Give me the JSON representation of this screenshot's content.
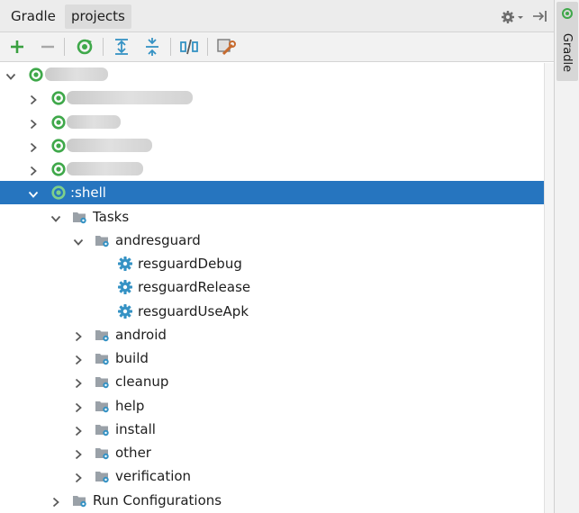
{
  "tabs": [
    {
      "label": "Gradle"
    },
    {
      "label": "projects"
    }
  ],
  "header_icons": [
    "gear-icon",
    "hide-panel-icon"
  ],
  "toolbar": {
    "buttons": [
      "add-icon",
      "remove-icon",
      "refresh-icon",
      "expand-all-icon",
      "collapse-all-icon",
      "toggle-offline-icon",
      "settings-wrench-icon"
    ]
  },
  "side_panel": {
    "label": "Gradle"
  },
  "tree": {
    "root_label": "",
    "modules": [
      "",
      "",
      "",
      ""
    ],
    "selected_module": ":shell",
    "tasks_label": "Tasks",
    "andresguard": {
      "label": "andresguard",
      "tasks": [
        "resguardDebug",
        "resguardRelease",
        "resguardUseApk"
      ]
    },
    "task_groups": [
      "android",
      "build",
      "cleanup",
      "help",
      "install",
      "other",
      "verification"
    ],
    "run_configurations_label": "Run Configurations"
  },
  "colors": {
    "selection": "#2675bf",
    "gradle_green": "#3fa84a",
    "add_green": "#3aa040",
    "gear_blue": "#3592c4"
  }
}
